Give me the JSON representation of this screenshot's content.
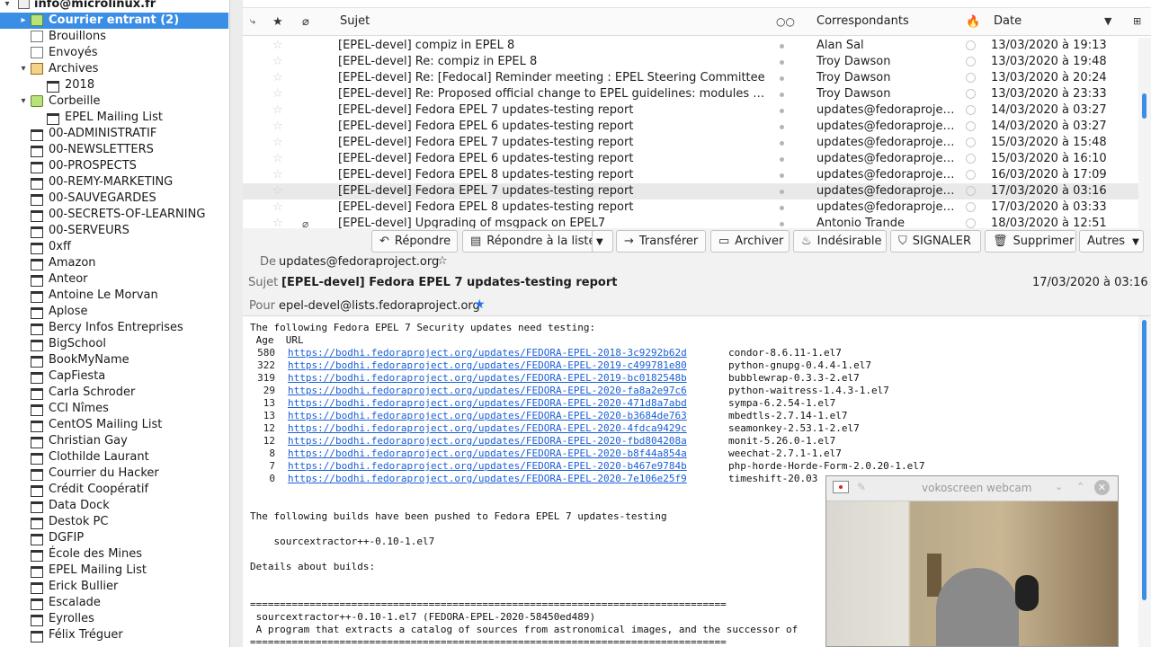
{
  "folders": {
    "account": "info@microlinux.fr",
    "items": [
      {
        "label": "Courrier entrant (2)",
        "icon": "inbox-icon",
        "indent": 1,
        "selected": true,
        "twisty": "▸"
      },
      {
        "label": "Brouillons",
        "icon": "drafts-icon",
        "indent": 1
      },
      {
        "label": "Envoyés",
        "icon": "sent-icon",
        "indent": 1
      },
      {
        "label": "Archives",
        "icon": "archive-icon",
        "indent": 1,
        "twisty": "▾"
      },
      {
        "label": "2018",
        "icon": "folder-icon",
        "indent": 2
      },
      {
        "label": "Corbeille",
        "icon": "trash-icon",
        "indent": 1,
        "twisty": "▾"
      },
      {
        "label": "EPEL Mailing List",
        "icon": "folder-icon",
        "indent": 2
      },
      {
        "label": "00-ADMINISTRATIF",
        "icon": "folder-icon",
        "indent": 1
      },
      {
        "label": "00-NEWSLETTERS",
        "icon": "folder-icon",
        "indent": 1
      },
      {
        "label": "00-PROSPECTS",
        "icon": "folder-icon",
        "indent": 1
      },
      {
        "label": "00-REMY-MARKETING",
        "icon": "folder-icon",
        "indent": 1
      },
      {
        "label": "00-SAUVEGARDES",
        "icon": "folder-icon",
        "indent": 1
      },
      {
        "label": "00-SECRETS-OF-LEARNING",
        "icon": "folder-icon",
        "indent": 1
      },
      {
        "label": "00-SERVEURS",
        "icon": "folder-icon",
        "indent": 1
      },
      {
        "label": "0xff",
        "icon": "folder-icon",
        "indent": 1
      },
      {
        "label": "Amazon",
        "icon": "folder-icon",
        "indent": 1
      },
      {
        "label": "Anteor",
        "icon": "folder-icon",
        "indent": 1
      },
      {
        "label": "Antoine Le Morvan",
        "icon": "folder-icon",
        "indent": 1
      },
      {
        "label": "Aplose",
        "icon": "folder-icon",
        "indent": 1
      },
      {
        "label": "Bercy Infos Entreprises",
        "icon": "folder-icon",
        "indent": 1
      },
      {
        "label": "BigSchool",
        "icon": "folder-icon",
        "indent": 1
      },
      {
        "label": "BookMyName",
        "icon": "folder-icon",
        "indent": 1
      },
      {
        "label": "CapFiesta",
        "icon": "folder-icon",
        "indent": 1
      },
      {
        "label": "Carla Schroder",
        "icon": "folder-icon",
        "indent": 1
      },
      {
        "label": "CCI Nîmes",
        "icon": "folder-icon",
        "indent": 1
      },
      {
        "label": "CentOS Mailing List",
        "icon": "folder-icon",
        "indent": 1
      },
      {
        "label": "Christian Gay",
        "icon": "folder-icon",
        "indent": 1
      },
      {
        "label": "Clothilde Laurant",
        "icon": "folder-icon",
        "indent": 1
      },
      {
        "label": "Courrier du Hacker",
        "icon": "folder-icon",
        "indent": 1
      },
      {
        "label": "Crédit Coopératif",
        "icon": "folder-icon",
        "indent": 1
      },
      {
        "label": "Data Dock",
        "icon": "folder-icon",
        "indent": 1
      },
      {
        "label": "Destok PC",
        "icon": "folder-icon",
        "indent": 1
      },
      {
        "label": "DGFIP",
        "icon": "folder-icon",
        "indent": 1
      },
      {
        "label": "École des Mines",
        "icon": "folder-icon",
        "indent": 1
      },
      {
        "label": "EPEL Mailing List",
        "icon": "folder-icon",
        "indent": 1
      },
      {
        "label": "Erick Bullier",
        "icon": "folder-icon",
        "indent": 1
      },
      {
        "label": "Escalade",
        "icon": "folder-icon",
        "indent": 1
      },
      {
        "label": "Eyrolles",
        "icon": "folder-icon",
        "indent": 1
      },
      {
        "label": "Félix Tréguer",
        "icon": "folder-icon",
        "indent": 1
      }
    ]
  },
  "message_list": {
    "columns": {
      "subject": "Sujet",
      "correspondents": "Correspondants",
      "date": "Date"
    },
    "rows": [
      {
        "subject": "[EPEL-devel] compiz in EPEL 8",
        "sender": "Alan Sal",
        "date": "13/03/2020 à 19:13"
      },
      {
        "subject": "[EPEL-devel] Re: compiz in EPEL 8",
        "sender": "Troy Dawson",
        "date": "13/03/2020 à 19:48"
      },
      {
        "subject": "[EPEL-devel] Re: [Fedocal] Reminder meeting : EPEL Steering Committee",
        "sender": "Troy Dawson",
        "date": "13/03/2020 à 20:24"
      },
      {
        "subject": "[EPEL-devel] Re: Proposed official change to EPEL guidelines: modules and R...",
        "sender": "Troy Dawson",
        "date": "13/03/2020 à 23:33"
      },
      {
        "subject": "[EPEL-devel] Fedora EPEL 7 updates-testing report",
        "sender": "updates@fedoraprojec...",
        "date": "14/03/2020 à 03:27"
      },
      {
        "subject": "[EPEL-devel] Fedora EPEL 6 updates-testing report",
        "sender": "updates@fedoraprojec...",
        "date": "14/03/2020 à 03:27"
      },
      {
        "subject": "[EPEL-devel] Fedora EPEL 7 updates-testing report",
        "sender": "updates@fedoraprojec...",
        "date": "15/03/2020 à 15:48"
      },
      {
        "subject": "[EPEL-devel] Fedora EPEL 6 updates-testing report",
        "sender": "updates@fedoraprojec...",
        "date": "15/03/2020 à 16:10"
      },
      {
        "subject": "[EPEL-devel] Fedora EPEL 8 updates-testing report",
        "sender": "updates@fedoraprojec...",
        "date": "16/03/2020 à 17:09"
      },
      {
        "subject": "[EPEL-devel] Fedora EPEL 7 updates-testing report",
        "sender": "updates@fedoraprojec...",
        "date": "17/03/2020 à 03:16",
        "hover": true
      },
      {
        "subject": "[EPEL-devel] Fedora EPEL 8 updates-testing report",
        "sender": "updates@fedoraprojec...",
        "date": "17/03/2020 à 03:33"
      },
      {
        "subject": "[EPEL-devel] Upgrading of msgpack on EPEL7",
        "sender": "Antonio Trande",
        "date": "18/03/2020 à 12:51",
        "attachment": true
      }
    ]
  },
  "toolbar": {
    "reply": "Répondre",
    "reply_list": "Répondre à la liste",
    "forward": "Transférer",
    "archive": "Archiver",
    "junk": "Indésirable",
    "report": "SIGNALER",
    "delete": "Supprimer",
    "more": "Autres"
  },
  "headers": {
    "from_label": "De",
    "from": "updates@fedoraproject.org",
    "subject_label": "Sujet",
    "subject": "[EPEL-devel] Fedora EPEL 7 updates-testing report",
    "date": "17/03/2020 à 03:16",
    "to_label": "Pour",
    "to": "epel-devel@lists.fedoraproject.org"
  },
  "body": {
    "intro": "The following Fedora EPEL 7 Security updates need testing:",
    "col_header": " Age  URL",
    "updates": [
      {
        "age": "580",
        "url": "https://bodhi.fedoraproject.org/updates/FEDORA-EPEL-2018-3c9292b62d",
        "pkg": "condor-8.6.11-1.el7"
      },
      {
        "age": "322",
        "url": "https://bodhi.fedoraproject.org/updates/FEDORA-EPEL-2019-c499781e80",
        "pkg": "python-gnupg-0.4.4-1.el7"
      },
      {
        "age": "319",
        "url": "https://bodhi.fedoraproject.org/updates/FEDORA-EPEL-2019-bc0182548b",
        "pkg": "bubblewrap-0.3.3-2.el7"
      },
      {
        "age": "29",
        "url": "https://bodhi.fedoraproject.org/updates/FEDORA-EPEL-2020-fa8a2e97c6",
        "pkg": "python-waitress-1.4.3-1.el7"
      },
      {
        "age": "13",
        "url": "https://bodhi.fedoraproject.org/updates/FEDORA-EPEL-2020-471d8a7abd",
        "pkg": "sympa-6.2.54-1.el7"
      },
      {
        "age": "13",
        "url": "https://bodhi.fedoraproject.org/updates/FEDORA-EPEL-2020-b3684de763",
        "pkg": "mbedtls-2.7.14-1.el7"
      },
      {
        "age": "12",
        "url": "https://bodhi.fedoraproject.org/updates/FEDORA-EPEL-2020-4fdca9429c",
        "pkg": "seamonkey-2.53.1-2.el7"
      },
      {
        "age": "12",
        "url": "https://bodhi.fedoraproject.org/updates/FEDORA-EPEL-2020-fbd804208a",
        "pkg": "monit-5.26.0-1.el7"
      },
      {
        "age": "8",
        "url": "https://bodhi.fedoraproject.org/updates/FEDORA-EPEL-2020-b8f44a854a",
        "pkg": "weechat-2.7.1-1.el7"
      },
      {
        "age": "7",
        "url": "https://bodhi.fedoraproject.org/updates/FEDORA-EPEL-2020-b467e9784b",
        "pkg": "php-horde-Horde-Form-2.0.20-1.el7"
      },
      {
        "age": "0",
        "url": "https://bodhi.fedoraproject.org/updates/FEDORA-EPEL-2020-7e106e25f9",
        "pkg": "timeshift-20.03"
      }
    ],
    "pushed": "The following builds have been pushed to Fedora EPEL 7 updates-testing",
    "pushed_build": "    sourcextractor++-0.10-1.el7",
    "details": "Details about builds:",
    "separator": "================================================================================",
    "build_line": " sourcextractor++-0.10-1.el7 (FEDORA-EPEL-2020-58450ed489)",
    "desc_line": " A program that extracts a catalog of sources from astronomical images, and the successor of"
  },
  "webcam": {
    "title": "vokoscreen webcam"
  },
  "colors": {
    "selection": "#3a8ee6",
    "link": "#1a5fd6",
    "hover_row": "#e9e9e9"
  }
}
